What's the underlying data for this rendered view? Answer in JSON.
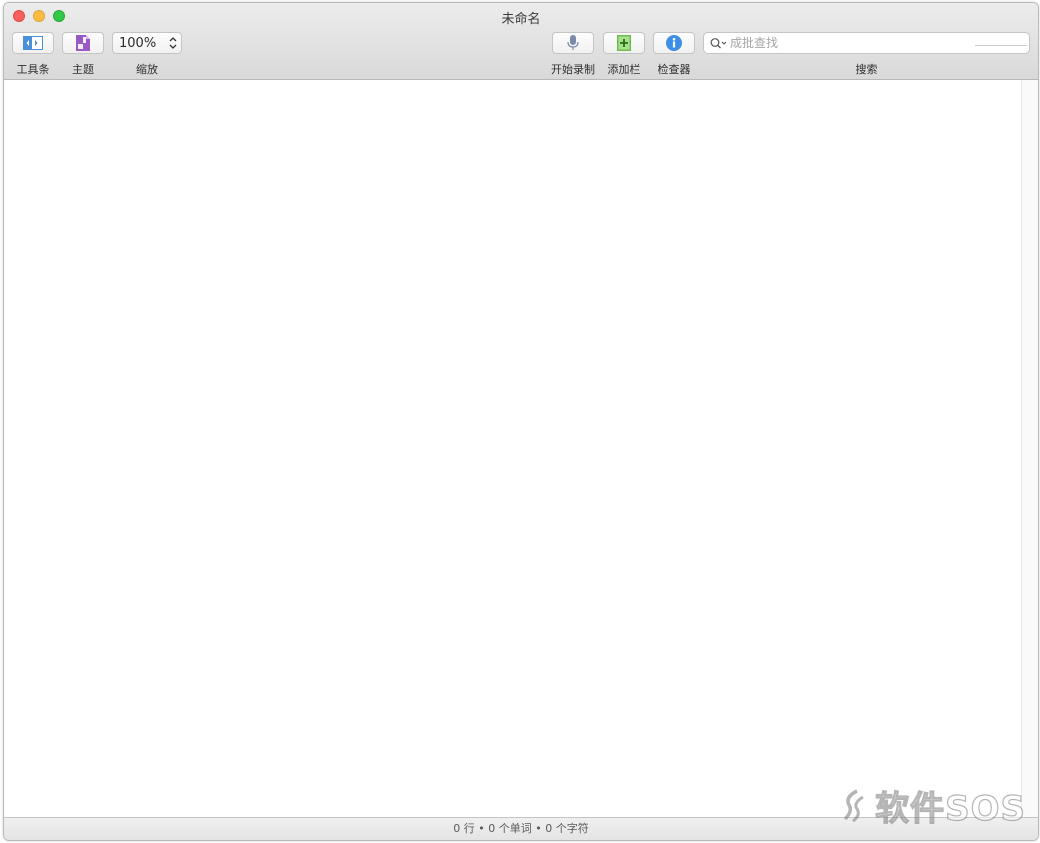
{
  "window": {
    "title": "未命名"
  },
  "toolbar": {
    "sidebar_label": "工具条",
    "theme_label": "主题",
    "zoom_label": "缩放",
    "zoom_value": "100%",
    "record_label": "开始录制",
    "add_sheet_label": "添加栏",
    "inspector_label": "检查器",
    "search_label": "搜索",
    "search_placeholder": "成批查找",
    "search_value": ""
  },
  "status": {
    "text": "0 行 • 0 个单词 • 0 个字符"
  },
  "watermark": {
    "text": "软件SOS"
  },
  "colors": {
    "close": "#fc605c",
    "minimize": "#fdbc40",
    "maximize": "#34c84a",
    "sidebar_icon": "#4a90d9",
    "theme_icon": "#9b59c6",
    "add_icon": "#6cbf4c",
    "inspector_icon": "#3d8ee6",
    "mic_icon": "#7a8aa8"
  },
  "icons": {
    "sidebar": "sidebar-toggle-icon",
    "theme": "theme-palette-icon",
    "record": "microphone-icon",
    "add_sheet": "add-sheet-icon",
    "inspector": "info-icon",
    "search": "magnifier-icon"
  }
}
